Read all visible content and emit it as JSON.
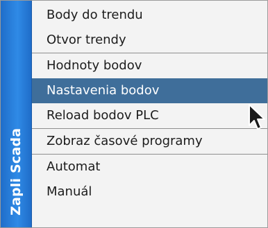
{
  "side_title": "Zapli Scada",
  "menu": {
    "groups": [
      {
        "items": [
          {
            "label": "Body do trendu",
            "name": "menu-item-body-do-trendu",
            "active": false
          },
          {
            "label": "Otvor trendy",
            "name": "menu-item-otvor-trendy",
            "active": false
          }
        ]
      },
      {
        "items": [
          {
            "label": "Hodnoty bodov",
            "name": "menu-item-hodnoty-bodov",
            "active": false
          },
          {
            "label": "Nastavenia bodov",
            "name": "menu-item-nastavenia-bodov",
            "active": true
          },
          {
            "label": "Reload bodov PLC",
            "name": "menu-item-reload-bodov-plc",
            "active": false
          }
        ]
      },
      {
        "items": [
          {
            "label": "Zobraz časové programy",
            "name": "menu-item-zobraz-casove-programy",
            "active": false
          }
        ]
      },
      {
        "items": [
          {
            "label": "Automat",
            "name": "menu-item-automat",
            "active": false
          },
          {
            "label": "Manuál",
            "name": "menu-item-manual",
            "active": false
          }
        ]
      }
    ]
  },
  "colors": {
    "side_strip": "#2f8ae6",
    "highlight": "#3f6e9a",
    "menu_background": "#f3f3f3"
  },
  "cursor_icon": "arrow-pointer-icon"
}
